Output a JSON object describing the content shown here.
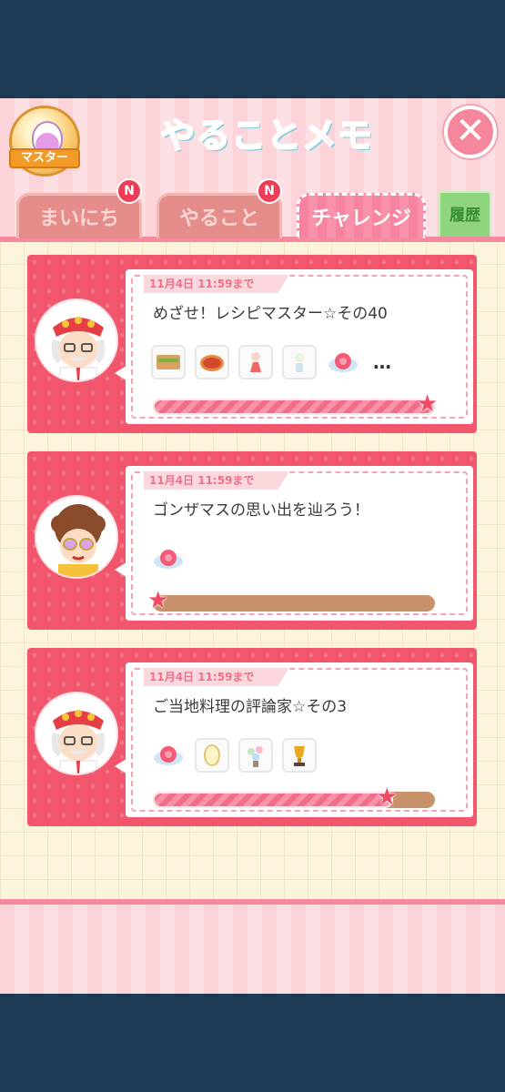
{
  "header": {
    "badge_label": "マスター",
    "title": "やることメモ",
    "close_label": "✕"
  },
  "tabs": [
    {
      "label": "まいにち",
      "badge": "N"
    },
    {
      "label": "やること",
      "badge": "N"
    },
    {
      "label": "チャレンジ"
    },
    {
      "label": "履歴"
    }
  ],
  "tasks": [
    {
      "deadline": "11月4日 11:59まで",
      "title": "めざせ！レシピマスター☆その40",
      "more": "…",
      "progress": 1.0
    },
    {
      "deadline": "11月4日 11:59まで",
      "title": "ゴンザマスの思い出を辿ろう！",
      "progress": 0.0
    },
    {
      "deadline": "11月4日 11:59まで",
      "title": "ご当地料理の評論家☆その3",
      "progress": 0.85
    }
  ],
  "colors": {
    "card": "#f2566c",
    "progress_fill": "#f26d89",
    "progress_track": "#c79169",
    "accent": "#ff6f93"
  }
}
